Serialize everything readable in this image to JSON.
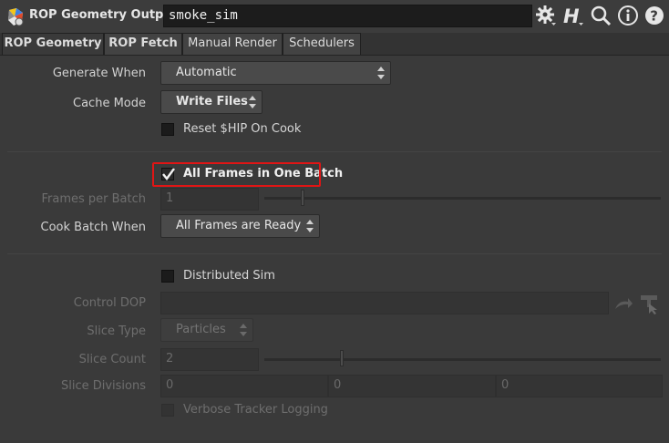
{
  "header": {
    "node_type": "ROP Geometry Output",
    "node_name": "smoke_sim"
  },
  "tabs": [
    {
      "label": "ROP Geometry",
      "active": true
    },
    {
      "label": "ROP Fetch",
      "active": false
    },
    {
      "label": "Manual Render",
      "active": false
    },
    {
      "label": "Schedulers",
      "active": false
    }
  ],
  "params": {
    "generate_when": {
      "label": "Generate When",
      "value": "Automatic"
    },
    "cache_mode": {
      "label": "Cache Mode",
      "value": "Write Files"
    },
    "reset_hip": {
      "label": "Reset $HIP On Cook",
      "checked": false
    },
    "all_frames_batch": {
      "label": "All Frames in One Batch",
      "checked": true
    },
    "frames_per_batch": {
      "label": "Frames per Batch",
      "value": "1"
    },
    "cook_batch_when": {
      "label": "Cook Batch When",
      "value": "All Frames are Ready"
    },
    "distributed_sim": {
      "label": "Distributed Sim",
      "checked": false
    },
    "control_dop": {
      "label": "Control DOP",
      "value": ""
    },
    "slice_type": {
      "label": "Slice Type",
      "value": "Particles"
    },
    "slice_count": {
      "label": "Slice Count",
      "value": "2"
    },
    "slice_divisions": {
      "label": "Slice Divisions",
      "values": [
        "0",
        "0",
        "0"
      ]
    },
    "verbose_logging": {
      "label": "Verbose Tracker Logging",
      "checked": false
    }
  },
  "colors": {
    "highlight": "#e01515",
    "background": "#3a3a3a"
  }
}
